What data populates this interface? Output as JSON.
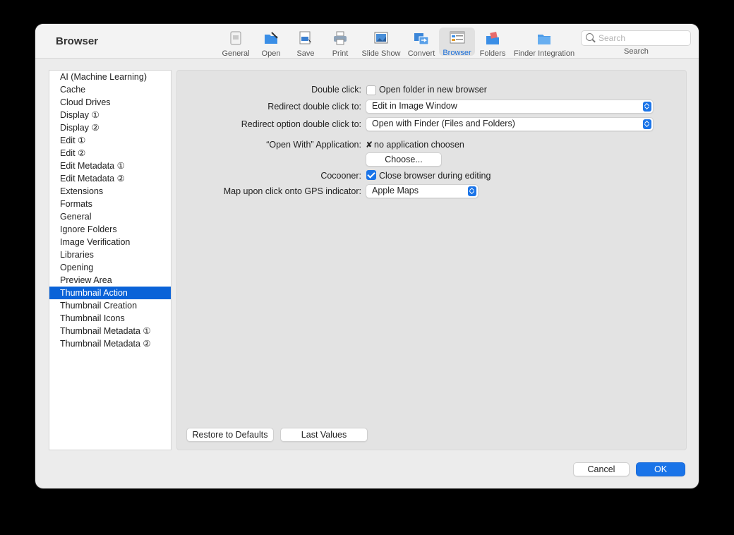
{
  "window": {
    "title": "Browser"
  },
  "toolbar": {
    "items": [
      {
        "label": "General",
        "icon": "general-icon"
      },
      {
        "label": "Open",
        "icon": "open-icon"
      },
      {
        "label": "Save",
        "icon": "save-icon"
      },
      {
        "label": "Print",
        "icon": "printer-icon"
      },
      {
        "label": "Slide Show",
        "icon": "slideshow-icon"
      },
      {
        "label": "Convert",
        "icon": "convert-icon"
      },
      {
        "label": "Browser",
        "icon": "browser-icon",
        "selected": true
      },
      {
        "label": "Folders",
        "icon": "folders-icon"
      },
      {
        "label": "Finder Integration",
        "icon": "finder-folder-icon"
      }
    ],
    "search": {
      "placeholder": "Search",
      "label": "Search",
      "value": ""
    }
  },
  "sidebar": {
    "items": [
      {
        "label": "AI (Machine Learning)"
      },
      {
        "label": "Cache"
      },
      {
        "label": "Cloud Drives"
      },
      {
        "label": "Display ①"
      },
      {
        "label": "Display ②"
      },
      {
        "label": "Edit ①"
      },
      {
        "label": "Edit ②"
      },
      {
        "label": "Edit Metadata ①"
      },
      {
        "label": "Edit Metadata ②"
      },
      {
        "label": "Extensions"
      },
      {
        "label": "Formats"
      },
      {
        "label": "General"
      },
      {
        "label": "Ignore Folders"
      },
      {
        "label": "Image Verification"
      },
      {
        "label": "Libraries"
      },
      {
        "label": "Opening"
      },
      {
        "label": "Preview Area"
      },
      {
        "label": "Thumbnail Action",
        "selected": true
      },
      {
        "label": "Thumbnail Creation"
      },
      {
        "label": "Thumbnail Icons"
      },
      {
        "label": "Thumbnail Metadata ①"
      },
      {
        "label": "Thumbnail Metadata ②"
      }
    ]
  },
  "settings": {
    "double_click": {
      "label": "Double click:",
      "checkbox_label": "Open folder in new browser",
      "checked": false
    },
    "redirect_double_click": {
      "label": "Redirect double click to:",
      "value": "Edit in Image Window"
    },
    "redirect_option_double_click": {
      "label": "Redirect option double click to:",
      "value": "Open with Finder (Files and Folders)"
    },
    "open_with_app": {
      "label": "“Open With” Application:",
      "mark": "✘",
      "value": "no application choosen",
      "choose_button": "Choose..."
    },
    "cocooner": {
      "label": "Cocooner:",
      "checkbox_label": "Close browser during editing",
      "checked": true
    },
    "map_gps": {
      "label": "Map upon click onto GPS indicator:",
      "value": "Apple Maps"
    }
  },
  "panel_buttons": {
    "restore_defaults": "Restore to Defaults",
    "last_values": "Last Values"
  },
  "dialog_buttons": {
    "cancel": "Cancel",
    "ok": "OK"
  },
  "colors": {
    "accent": "#1a74e8",
    "selection": "#0a63d8"
  }
}
